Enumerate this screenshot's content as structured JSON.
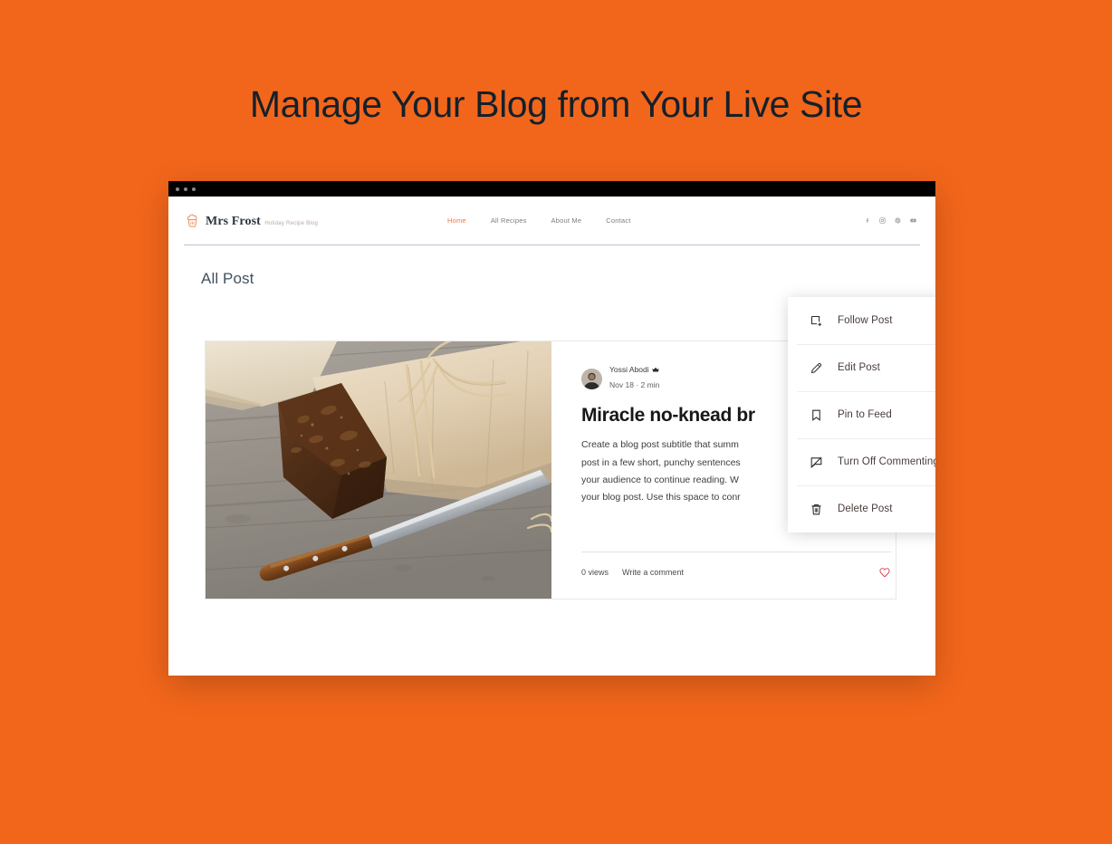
{
  "headline": "Manage Your Blog from Your Live Site",
  "colors": {
    "background_orange": "#F2661B",
    "nav_active": "#F2753B",
    "heart_red": "#E03E52",
    "headline_text": "#15202B"
  },
  "browser": {
    "chrome_dots": 3
  },
  "site": {
    "logo": {
      "icon": "cupcake-icon",
      "name": "Mrs Frost",
      "tagline": "Holiday Recipe Blog"
    },
    "nav": [
      {
        "label": "Home",
        "active": true
      },
      {
        "label": "All Recipes",
        "active": false
      },
      {
        "label": "About Me",
        "active": false
      },
      {
        "label": "Contact",
        "active": false
      }
    ],
    "social": [
      {
        "icon": "facebook-icon",
        "label": "Facebook"
      },
      {
        "icon": "instagram-icon",
        "label": "Instagram"
      },
      {
        "icon": "pinterest-icon",
        "label": "Pinterest"
      },
      {
        "icon": "youtube-icon",
        "label": "YouTube"
      }
    ]
  },
  "page": {
    "title": "All Post"
  },
  "post": {
    "image_alt": "no-knead-bread-photo",
    "author": {
      "name": "Yossi Abodi",
      "badge": "crown-icon",
      "avatar": "author-avatar"
    },
    "date": "Nov 18",
    "separator": "·",
    "read_time": "2 min",
    "title": "Miracle no-knead br",
    "excerpt": "Create a blog post subtitle that summ post in a few short, punchy sentences your audience to continue reading. W your blog post. Use this space to conr",
    "excerpt_lines": [
      "Create a blog post subtitle that summ",
      "post in a few short, punchy sentences",
      "your audience to continue reading. W",
      "your blog post. Use this space to conr"
    ],
    "views": "0 views",
    "comment_action": "Write a comment",
    "like_icon": "heart-icon"
  },
  "menu": {
    "more_icon": "more-vertical-icon",
    "items": [
      {
        "label": "Follow Post",
        "icon": "follow-post-icon"
      },
      {
        "label": "Edit Post",
        "icon": "pencil-icon"
      },
      {
        "label": "Pin to Feed",
        "icon": "bookmark-icon"
      },
      {
        "label": "Turn Off Commenting",
        "icon": "comment-off-icon"
      },
      {
        "label": "Delete Post",
        "icon": "trash-icon"
      }
    ]
  }
}
